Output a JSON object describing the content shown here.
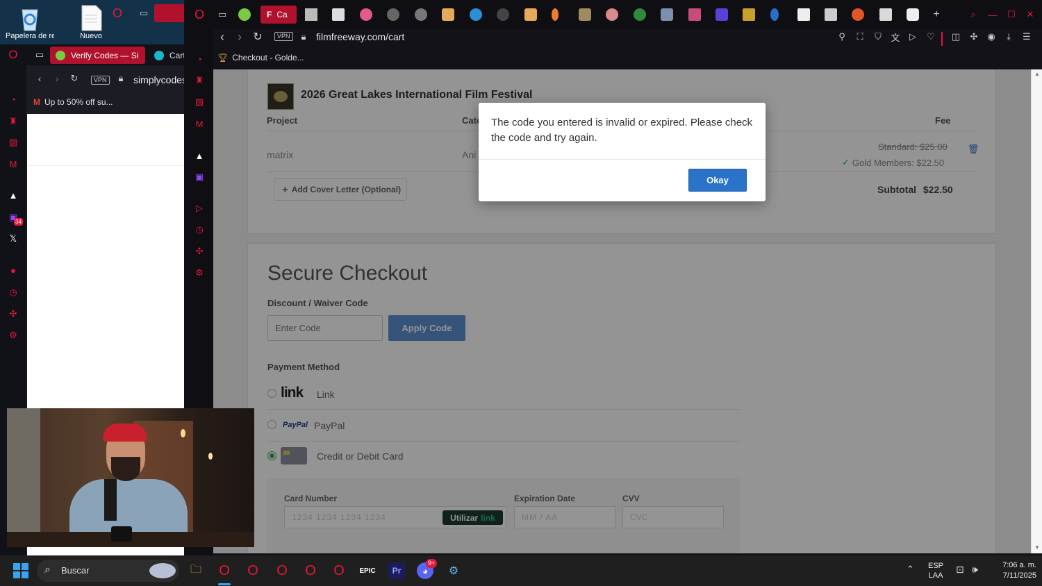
{
  "desktop": {
    "icons": [
      {
        "label": "Papelera de reciclaje"
      },
      {
        "label": "Nuevo"
      }
    ]
  },
  "back_window": {
    "tab_verify": "Verify Codes — Si",
    "tab_cart": "Cart",
    "url": "simplycodes",
    "vpn": "VPN",
    "bookmark": "Up to 50% off su...",
    "sidebar_badge": "34"
  },
  "front_window": {
    "active_tab": "Ca",
    "url": "filmfreeway.com/cart",
    "vpn": "VPN",
    "bookmark": "Checkout - Golde..."
  },
  "cart": {
    "festival_name": "2026 Great Lakes International Film Festival",
    "col_project": "Project",
    "col_category": "Cate",
    "col_fee": "Fee",
    "project_name": "matrix",
    "category_value": "Ani",
    "standard_fee": "Standard: $25.00",
    "gold_fee": "Gold Members: $22.50",
    "add_cover_letter": "Add Cover Letter (Optional)",
    "subtotal_label": "Subtotal",
    "subtotal_value": "$22.50"
  },
  "checkout": {
    "title": "Secure Checkout",
    "discount_label": "Discount / Waiver Code",
    "code_placeholder": "Enter Code",
    "apply_button": "Apply Code",
    "payment_label": "Payment Method",
    "methods": [
      {
        "logo": "link",
        "label": "Link"
      },
      {
        "logo": "PayPal",
        "label": "PayPal"
      },
      {
        "label": "Credit or Debit Card"
      }
    ],
    "card_number_label": "Card Number",
    "card_number_placeholder": "1234 1234 1234 1234",
    "utilizar": "Utilizar",
    "utilizar_link": "link",
    "expiration_label": "Expiration Date",
    "expiration_placeholder": "MM / AA",
    "cvv_label": "CVV",
    "cvv_placeholder": "CVC"
  },
  "modal": {
    "message": "The code you entered is invalid or expired. Please check the code and try again.",
    "button": "Okay"
  },
  "taskbar": {
    "search_placeholder": "Buscar",
    "lang_top": "ESP",
    "lang_bottom": "LAA",
    "time": "7:06 a. m.",
    "date": "7/11/2025",
    "discord_badge": "9+"
  },
  "colors": {
    "opera_red": "#e8163c",
    "okay_blue": "#2a73c9",
    "apply_blue": "#5d8fd3",
    "link_green": "#33b37e"
  }
}
